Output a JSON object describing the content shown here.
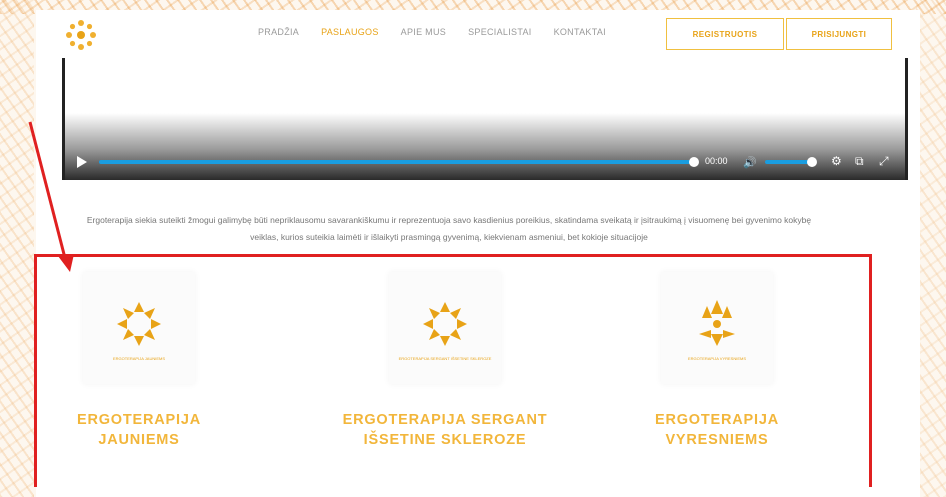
{
  "header": {
    "nav": [
      "PRADŽIA",
      "PASLAUGOS",
      "APIE MUS",
      "SPECIALISTAI",
      "KONTAKTAI"
    ],
    "nav_active_index": 1,
    "register_label": "REGISTRUOTIS",
    "login_label": "PRISIJUNGTI"
  },
  "video": {
    "time": "00:00",
    "progress": 0.98,
    "volume": 0.9
  },
  "description": {
    "line1": "Ergoterapija siekia suteikti žmogui galimybę būti nepriklausomu savarankiškumu ir reprezentuoja savo kasdienius poreikius, skatindama sveikatą ir įsitraukimą į visuomenę bei gyvenimo kokybę",
    "line2": "veiklas, kurios suteikia laimėti ir išlaikyti prasmingą gyvenimą, kiekvienam asmeniui, bet kokioje situacijoje"
  },
  "cards": [
    {
      "title_line1": "ERGOTERAPIJA",
      "title_line2": "JAUNIEMS",
      "sub": "ERGOTERAPIJA JAUNIEMS"
    },
    {
      "title_line1": "ERGOTERAPIJA SERGANT",
      "title_line2": "IŠSETINE SKLEROZE",
      "sub": "ERGOTERAPIJA SERGANT IŠSETINE SKLEROZE"
    },
    {
      "title_line1": "ERGOTERAPIJA",
      "title_line2": "VYRESNIEMS",
      "sub": "ERGOTERAPIJA VYRESNIEMS"
    }
  ],
  "colors": {
    "accent": "#e8a317",
    "title": "#f2b63b",
    "highlight": "#e02020",
    "video_progress": "#1a9de0"
  },
  "icons": [
    "sun-logo-icon",
    "play-icon",
    "volume-icon",
    "settings-icon",
    "popout-icon",
    "fullscreen-icon",
    "arrow-annotation"
  ]
}
